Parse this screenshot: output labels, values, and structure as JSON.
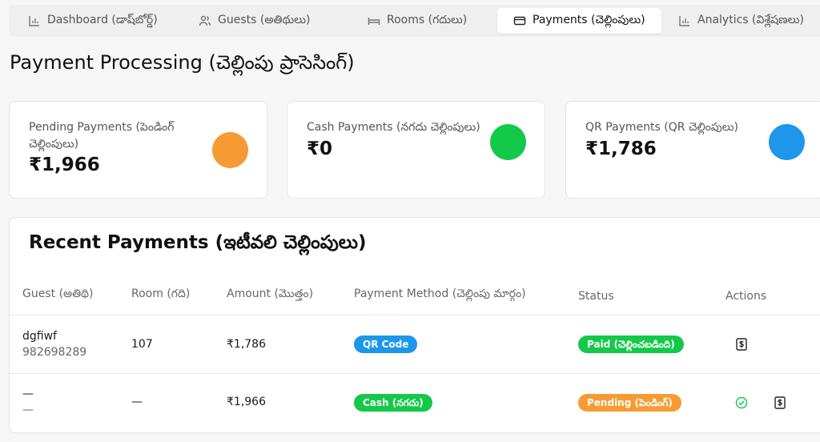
{
  "tabs": [
    {
      "label": "Dashboard (డాష్‌బోర్డ్)",
      "icon": "bar-chart-icon"
    },
    {
      "label": "Guests (అతిథులు)",
      "icon": "users-icon"
    },
    {
      "label": "Rooms (గదులు)",
      "icon": "bed-icon"
    },
    {
      "label": "Payments (చెల్లింపులు)",
      "icon": "credit-card-icon",
      "active": true
    },
    {
      "label": "Analytics (విశ్లేషణలు)",
      "icon": "bar-chart-icon"
    }
  ],
  "page_title": "Payment Processing (చెల్లింపు ప్రాసెసింగ్)",
  "summary": {
    "pending": {
      "label": "Pending Payments (పెండింగ్ చెల్లింపులు)",
      "value": "₹1,966",
      "color": "#f69b33"
    },
    "cash": {
      "label": "Cash Payments (నగదు చెల్లింపులు)",
      "value": "₹0",
      "color": "#14c94a"
    },
    "qr": {
      "label": "QR Payments (QR చెల్లింపులు)",
      "value": "₹1,786",
      "color": "#1e96ea"
    }
  },
  "recent": {
    "title": "Recent Payments (ఇటీవలి చెల్లింపులు)",
    "headers": {
      "guest": "Guest (అతిథి)",
      "room": "Room (గది)",
      "amount": "Amount (మొత్తం)",
      "method": "Payment Method (చెల్లింపు మార్గం)",
      "status": "Status",
      "actions": "Actions"
    },
    "rows": [
      {
        "guest_name": "dgfiwf",
        "guest_phone": "982698289",
        "room": "107",
        "amount": "₹1,786",
        "method": "QR Code",
        "status": "Paid (చెల్లించబడింది)"
      },
      {
        "guest_name": "—",
        "guest_phone": "—",
        "room": "—",
        "amount": "₹1,966",
        "method": "Cash (నగదు)",
        "status": "Pending (పెండింగ్)"
      }
    ]
  },
  "colors": {
    "qr": "#1e96ea",
    "cash": "#14c94a",
    "paid": "#14c94a",
    "pending": "#f69b33"
  }
}
